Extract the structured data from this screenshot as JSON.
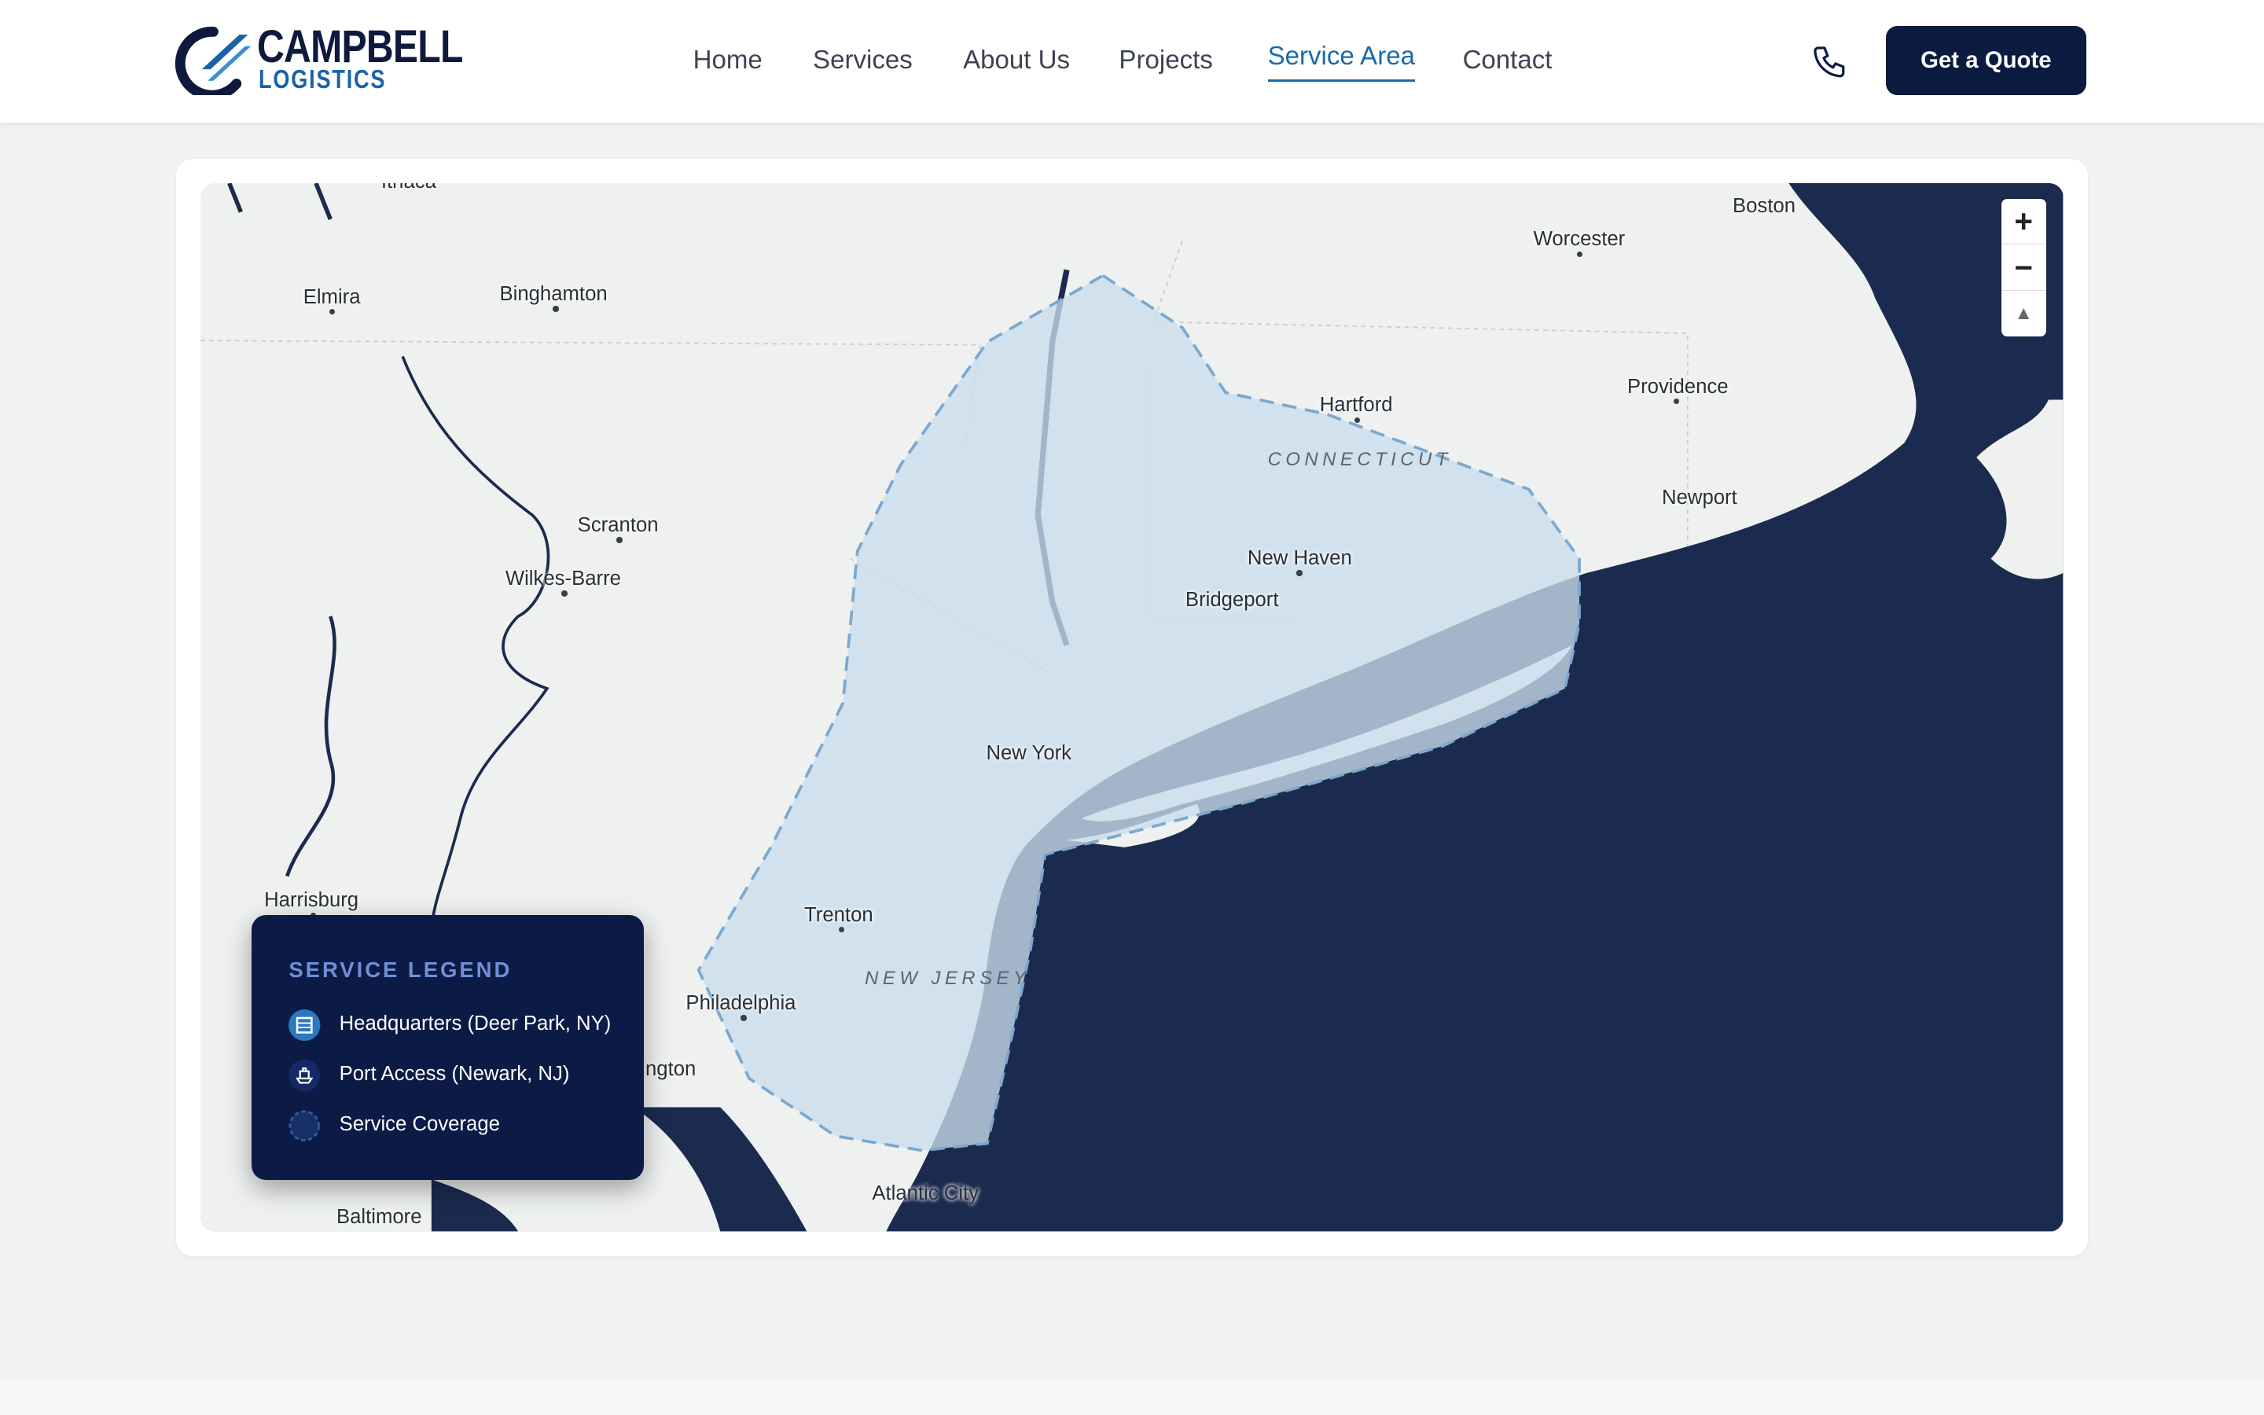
{
  "brand": {
    "name_line1": "CAMPBELL",
    "name_line2": "LOGISTICS"
  },
  "nav": {
    "items": [
      {
        "label": "Home",
        "active": false
      },
      {
        "label": "Services",
        "active": false
      },
      {
        "label": "About Us",
        "active": false
      },
      {
        "label": "Projects",
        "active": false
      },
      {
        "label": "Service Area",
        "active": true
      },
      {
        "label": "Contact",
        "active": false
      }
    ],
    "phone_icon": "phone-icon",
    "cta_label": "Get a Quote"
  },
  "map": {
    "cities": [
      "Ithaca",
      "Elmira",
      "Binghamton",
      "Scranton",
      "Wilkes-Barre",
      "Harrisburg",
      "Philadelphia",
      "Baltimore",
      "Trenton",
      "New York",
      "Bridgeport",
      "New Haven",
      "Hartford",
      "Worcester",
      "Boston",
      "Providence",
      "Newport",
      "Atlantic City",
      "ngton"
    ],
    "states": [
      "CONNECTICUT",
      "NEW JERSEY"
    ],
    "zoom_in_label": "+",
    "zoom_out_label": "−",
    "compass_label": "▲",
    "water_color": "#1b2b4f",
    "coverage_color": "#c9dcec"
  },
  "legend": {
    "title": "SERVICE LEGEND",
    "items": [
      {
        "label": "Headquarters (Deer Park, NY)",
        "icon": "building-icon"
      },
      {
        "label": "Port Access (Newark, NJ)",
        "icon": "ship-icon"
      },
      {
        "label": "Service Coverage",
        "icon": "coverage-area-icon"
      }
    ]
  }
}
